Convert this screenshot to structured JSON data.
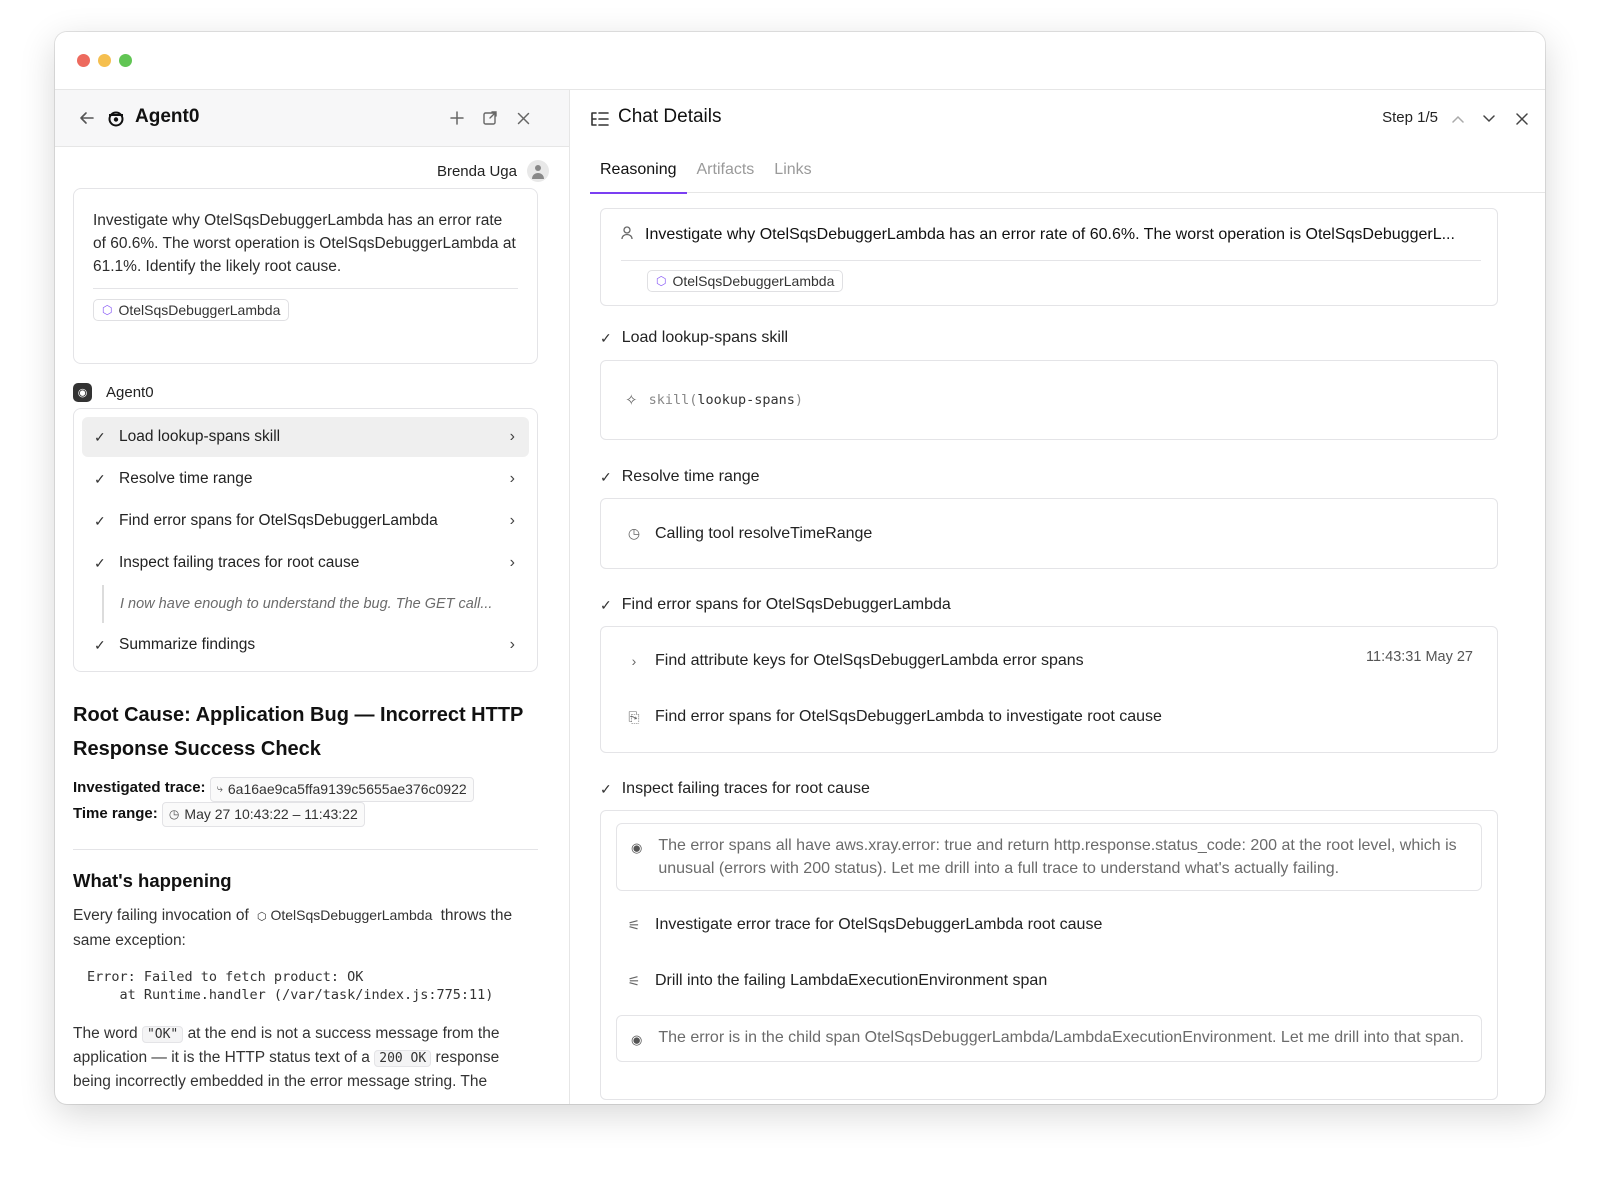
{
  "left_panel": {
    "title": "Agent0",
    "user_name": "Brenda Uga",
    "prompt": {
      "text": "Investigate why OtelSqsDebuggerLambda has an error rate of 60.6%. The worst operation is OtelSqsDebuggerLambda at 61.1%. Identify the likely root cause.",
      "chip": "OtelSqsDebuggerLambda"
    },
    "agent_label": "Agent0",
    "steps": [
      {
        "label": "Load lookup-spans skill"
      },
      {
        "label": "Resolve time range"
      },
      {
        "label": "Find error spans for OtelSqsDebuggerLambda"
      },
      {
        "label": "Inspect failing traces for root cause"
      },
      {
        "label": "Summarize findings"
      }
    ],
    "thought_preview": "I now have enough to understand the bug. The GET call...",
    "report": {
      "title": "Root Cause: Application Bug — Incorrect HTTP Response Success Check",
      "trace_label": "Investigated trace:",
      "trace_value": "6a16ae9ca5ffa9139c5655ae376c0922",
      "time_label": "Time range:",
      "time_value": "May 27 10:43:22 – 11:43:22",
      "section_title": "What's happening",
      "para1_a": "Every failing invocation of",
      "para1_chip": "OtelSqsDebuggerLambda",
      "para1_b": "throws the same exception:",
      "code": "Error: Failed to fetch product: OK\n    at Runtime.handler (/var/task/index.js:775:11)",
      "para2_a": "The word",
      "para2_code1": "\"OK\"",
      "para2_b": "at the end is not a success message from the application — it is the HTTP status text of a",
      "para2_code2": "200 OK",
      "para2_c": "response being incorrectly embedded in the error message string. The"
    }
  },
  "right_panel": {
    "title": "Chat Details",
    "step_indicator": "Step 1/5",
    "tabs": [
      "Reasoning",
      "Artifacts",
      "Links"
    ],
    "request": {
      "text": "Investigate why OtelSqsDebuggerLambda has an error rate of 60.6%. The worst operation is OtelSqsDebuggerL...",
      "chip": "OtelSqsDebuggerLambda"
    },
    "sections": [
      {
        "title": "Load lookup-spans skill",
        "skill_fn": "skill(",
        "skill_arg": "lookup-spans",
        "skill_end": ")"
      },
      {
        "title": "Resolve time range",
        "item": "Calling tool resolveTimeRange"
      },
      {
        "title": "Find error spans for OtelSqsDebuggerLambda",
        "item1": "Find attribute keys for OtelSqsDebuggerLambda error spans",
        "item1_time": "11:43:31 May 27",
        "item2": "Find error spans for OtelSqsDebuggerLambda to investigate root cause"
      },
      {
        "title": "Inspect failing traces for root cause",
        "thought1": "The error spans all have aws.xray.error: true and return http.response.status_code: 200 at the root level, which is unusual (errors with 200 status). Let me drill into a full trace to understand what's actually failing.",
        "item1": "Investigate error trace for OtelSqsDebuggerLambda root cause",
        "item2": "Drill into the failing LambdaExecutionEnvironment span",
        "thought2": "The error is in the child span OtelSqsDebuggerLambda/LambdaExecutionEnvironment. Let me drill into that span."
      }
    ]
  },
  "colors": {
    "accent": "#7b3ff2",
    "chip_icon": "#8a5cf6"
  }
}
